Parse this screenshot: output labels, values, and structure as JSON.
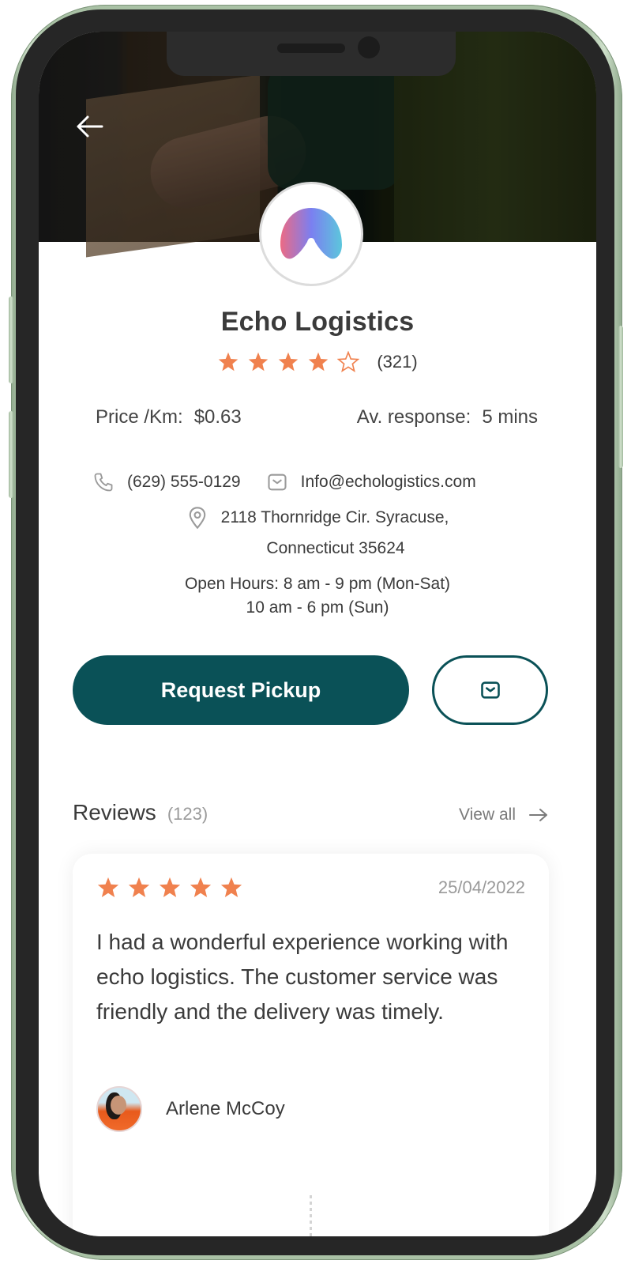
{
  "company": {
    "name": "Echo Logistics",
    "rating": 4,
    "rating_max": 5,
    "rating_count": "(321)",
    "logo_icon": "echo-logo-arch"
  },
  "stats": {
    "price_label": "Price /Km:",
    "price_value": "$0.63",
    "response_label": "Av. response:",
    "response_value": "5 mins"
  },
  "contact": {
    "phone": "(629) 555-0129",
    "email": "Info@echologistics.com",
    "address_line1": "2118 Thornridge Cir. Syracuse,",
    "address_line2": "Connecticut 35624",
    "hours_line1": "Open Hours: 8 am - 9 pm (Mon-Sat)",
    "hours_line2": "10 am - 6 pm (Sun)"
  },
  "actions": {
    "request_pickup_label": "Request Pickup",
    "message_icon": "mail-icon"
  },
  "nav": {
    "back_icon": "arrow-left-icon"
  },
  "reviews": {
    "title": "Reviews",
    "count": "(123)",
    "view_all_label": "View all",
    "items": [
      {
        "rating": 5,
        "date": "25/04/2022",
        "text": "I had a wonderful experience working with echo logistics. The customer service was friendly and the delivery was timely.",
        "author": "Arlene McCoy"
      }
    ]
  },
  "colors": {
    "primary": "#0a5157",
    "star": "#f0814e",
    "text": "#3b3b3b",
    "muted": "#9a9a9a",
    "frame": "#a9c1a5"
  }
}
